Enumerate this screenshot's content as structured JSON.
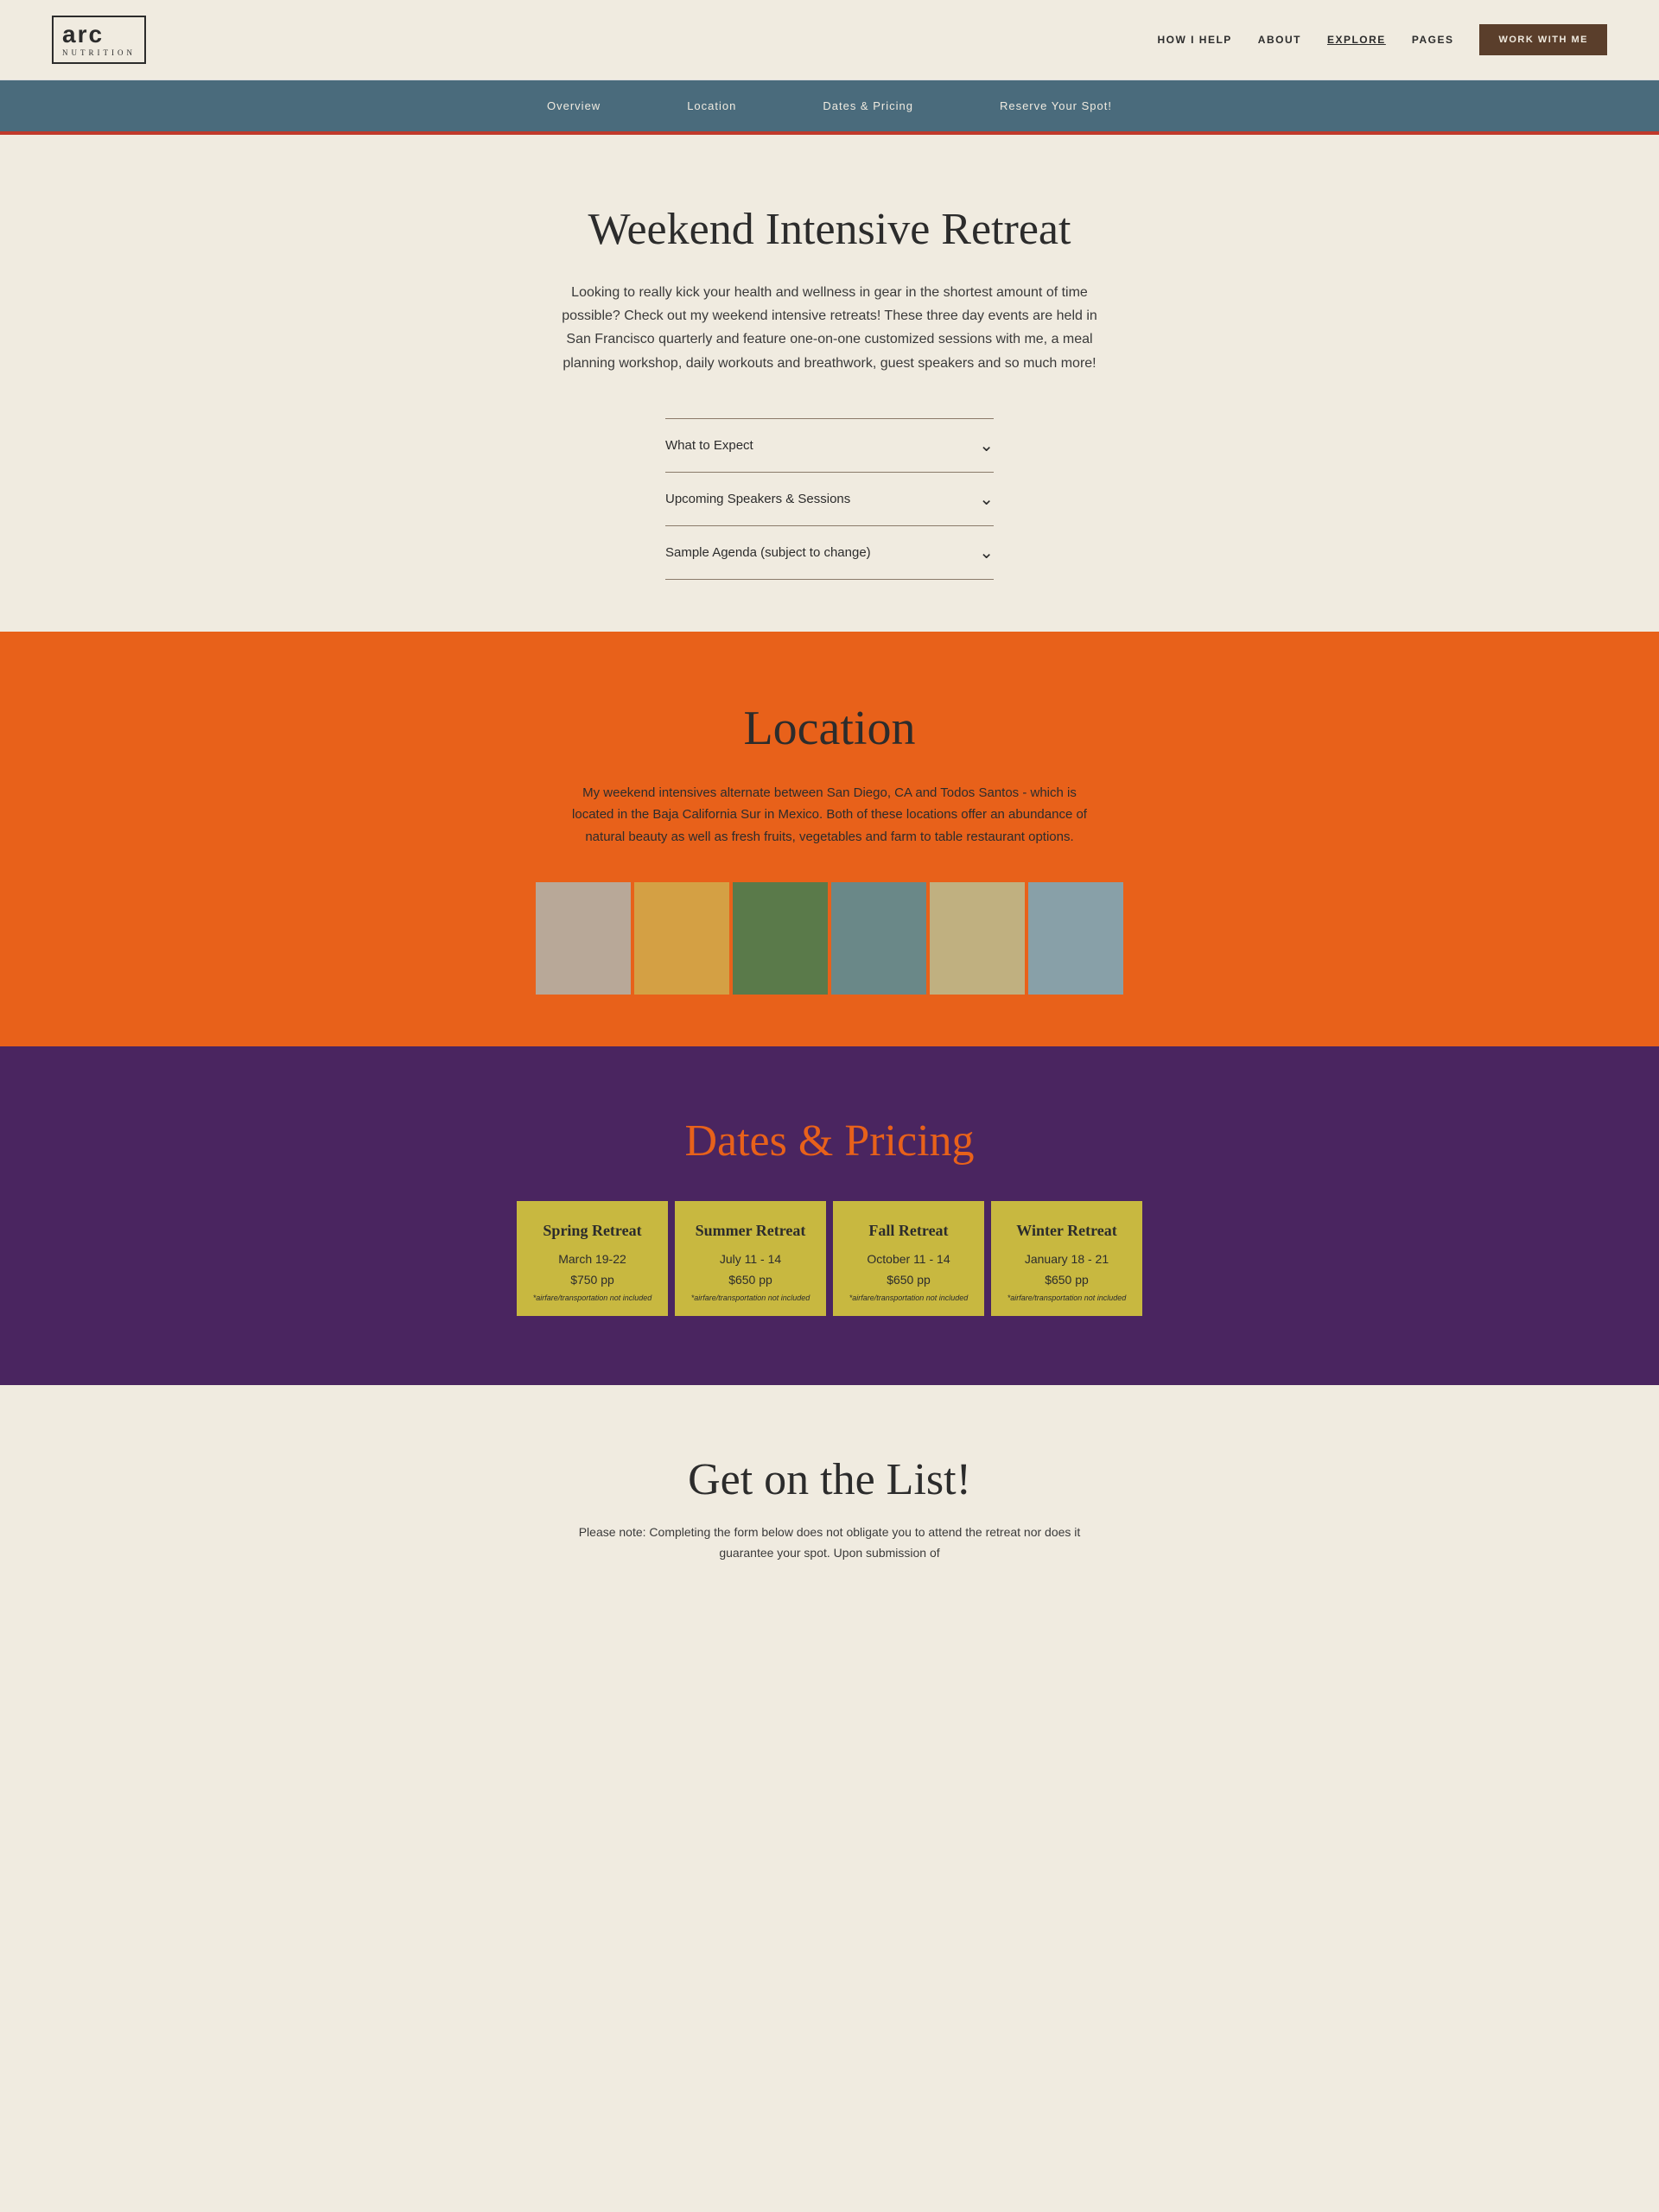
{
  "nav": {
    "logo_main": "arc",
    "logo_sub": "NUTRITION",
    "links": [
      {
        "label": "HOW I HELP",
        "active": false
      },
      {
        "label": "ABOUT",
        "active": false
      },
      {
        "label": "EXPLORE",
        "active": true
      },
      {
        "label": "PAGES",
        "active": false
      }
    ],
    "cta": "WORK WITH ME"
  },
  "sub_nav": {
    "links": [
      {
        "label": "Overview"
      },
      {
        "label": "Location"
      },
      {
        "label": "Dates & Pricing"
      },
      {
        "label": "Reserve Your Spot!"
      }
    ]
  },
  "hero": {
    "title": "Weekend Intensive Retreat",
    "description": "Looking to really kick your health and wellness in gear in the shortest amount of time possible? Check out my weekend intensive retreats! These three day events are held in San Francisco quarterly and feature one-on-one customized sessions with me, a meal planning workshop, daily workouts and breathwork, guest speakers and so much more!",
    "accordion": [
      {
        "label": "What to Expect"
      },
      {
        "label": "Upcoming Speakers & Sessions"
      },
      {
        "label": "Sample Agenda (subject to change)"
      }
    ]
  },
  "location": {
    "title": "Location",
    "description": "My weekend intensives alternate between San Diego, CA and Todos Santos - which is located in the Baja California Sur in Mexico. Both of these locations offer an abundance of natural beauty as well as fresh fruits, vegetables and farm to table restaurant options."
  },
  "dates": {
    "title": "Dates & Pricing",
    "cards": [
      {
        "name": "Spring Retreat",
        "date": "March 19-22",
        "price": "$750 pp",
        "disclaimer": "*airfare/transportation not included"
      },
      {
        "name": "Summer Retreat",
        "date": "July 11 - 14",
        "price": "$650 pp",
        "disclaimer": "*airfare/transportation not included"
      },
      {
        "name": "Fall Retreat",
        "date": "October 11 - 14",
        "price": "$650 pp",
        "disclaimer": "*airfare/transportation not included"
      },
      {
        "name": "Winter Retreat",
        "date": "January 18 - 21",
        "price": "$650 pp",
        "disclaimer": "*airfare/transportation not included"
      }
    ]
  },
  "getlist": {
    "title": "Get on the List!",
    "description": "Please note: Completing the form below does not obligate you to attend the retreat nor does it guarantee your spot. Upon submission of"
  }
}
